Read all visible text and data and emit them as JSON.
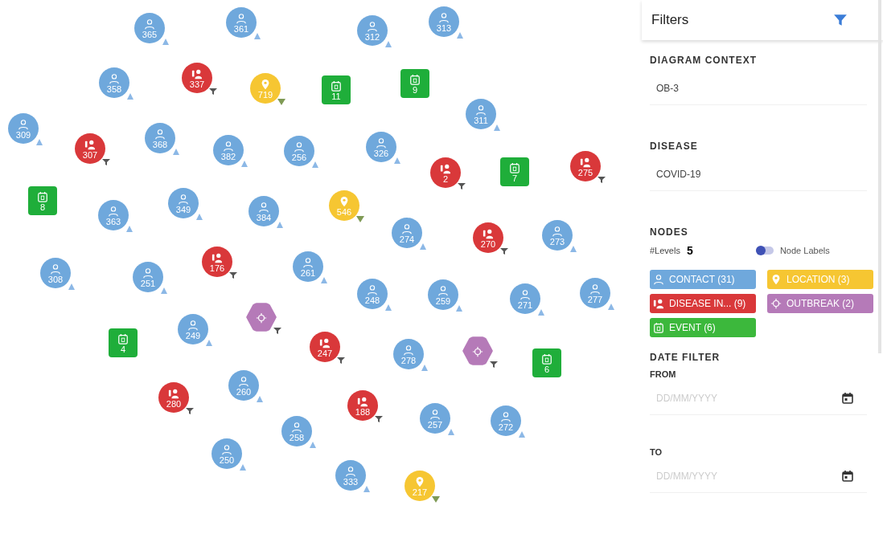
{
  "graph": {
    "nodes": [
      {
        "kind": "contact",
        "label": "365"
      },
      {
        "kind": "contact",
        "label": "361"
      },
      {
        "kind": "contact",
        "label": "312"
      },
      {
        "kind": "contact",
        "label": "313"
      },
      {
        "kind": "contact",
        "label": "358"
      },
      {
        "kind": "disease",
        "label": "337"
      },
      {
        "kind": "location",
        "label": "719"
      },
      {
        "kind": "event",
        "label": "11"
      },
      {
        "kind": "event",
        "label": "9"
      },
      {
        "kind": "contact",
        "label": "309"
      },
      {
        "kind": "disease",
        "label": "307"
      },
      {
        "kind": "contact",
        "label": "368"
      },
      {
        "kind": "contact",
        "label": "382"
      },
      {
        "kind": "contact",
        "label": "256"
      },
      {
        "kind": "contact",
        "label": "326"
      },
      {
        "kind": "contact",
        "label": "311"
      },
      {
        "kind": "disease",
        "label": "2"
      },
      {
        "kind": "event",
        "label": "7"
      },
      {
        "kind": "disease",
        "label": "275"
      },
      {
        "kind": "event",
        "label": "8"
      },
      {
        "kind": "contact",
        "label": "363"
      },
      {
        "kind": "contact",
        "label": "349"
      },
      {
        "kind": "contact",
        "label": "384"
      },
      {
        "kind": "location",
        "label": "546"
      },
      {
        "kind": "contact",
        "label": "274"
      },
      {
        "kind": "disease",
        "label": "270"
      },
      {
        "kind": "contact",
        "label": "273"
      },
      {
        "kind": "contact",
        "label": "308"
      },
      {
        "kind": "contact",
        "label": "251"
      },
      {
        "kind": "disease",
        "label": "176"
      },
      {
        "kind": "contact",
        "label": "261"
      },
      {
        "kind": "contact",
        "label": "248"
      },
      {
        "kind": "contact",
        "label": "259"
      },
      {
        "kind": "contact",
        "label": "271"
      },
      {
        "kind": "contact",
        "label": "277"
      },
      {
        "kind": "outbreak"
      },
      {
        "kind": "event",
        "label": "4"
      },
      {
        "kind": "contact",
        "label": "249"
      },
      {
        "kind": "disease",
        "label": "247"
      },
      {
        "kind": "contact",
        "label": "278"
      },
      {
        "kind": "outbreak"
      },
      {
        "kind": "event",
        "label": "6"
      },
      {
        "kind": "disease",
        "label": "280"
      },
      {
        "kind": "contact",
        "label": "260"
      },
      {
        "kind": "disease",
        "label": "188"
      },
      {
        "kind": "contact",
        "label": "257"
      },
      {
        "kind": "contact",
        "label": "272"
      },
      {
        "kind": "contact",
        "label": "258"
      },
      {
        "kind": "contact",
        "label": "250"
      },
      {
        "kind": "contact",
        "label": "333"
      },
      {
        "kind": "location",
        "label": "217"
      }
    ]
  },
  "filters": {
    "title": "Filters",
    "diagram_context": {
      "label": "DIAGRAM CONTEXT",
      "value": "OB-3"
    },
    "disease": {
      "label": "DISEASE",
      "value": "COVID-19"
    },
    "nodes": {
      "label": "NODES",
      "levels_label": "#Levels",
      "levels_value": "5",
      "node_labels": {
        "label": "Node Labels",
        "on": false
      },
      "types": [
        {
          "kind": "contact",
          "label": "CONTACT (31)",
          "color": "#6fa8dc"
        },
        {
          "kind": "location",
          "label": "LOCATION (3)",
          "color": "#f6c632"
        },
        {
          "kind": "disease",
          "label": "DISEASE IN... (9)",
          "color": "#d9383a"
        },
        {
          "kind": "outbreak",
          "label": "OUTBREAK (2)",
          "color": "#b57ab8"
        },
        {
          "kind": "event",
          "label": "EVENT (6)",
          "color": "#3cb83c"
        }
      ]
    },
    "date_filter": {
      "label": "DATE FILTER",
      "fields": [
        {
          "label": "FROM",
          "placeholder": "DD/MM/YYYY"
        },
        {
          "label": "TO",
          "placeholder": "DD/MM/YYYY"
        }
      ]
    }
  }
}
